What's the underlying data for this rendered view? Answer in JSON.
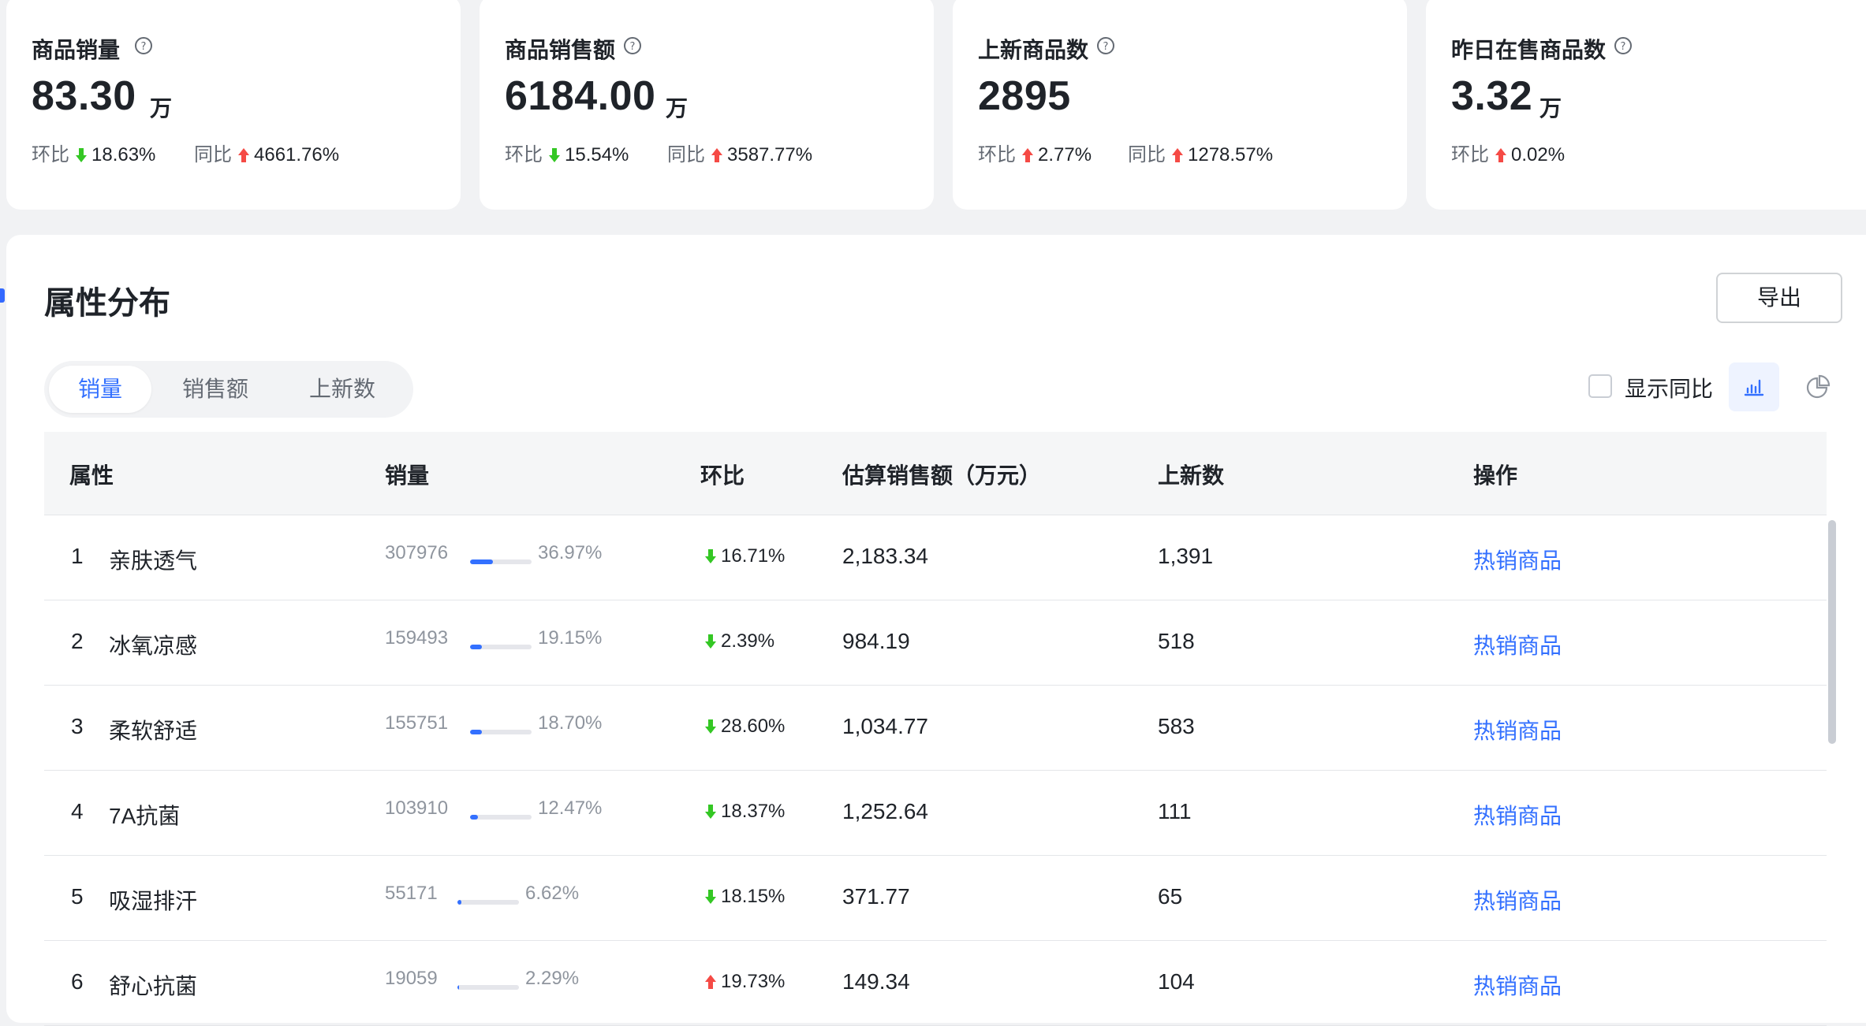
{
  "stats": [
    {
      "title": "商品销量",
      "value": "83.30",
      "unit": "万",
      "mom_label": "环比",
      "mom": "18.63%",
      "mom_dir": "down",
      "yoy_label": "同比",
      "yoy": "4661.76%",
      "yoy_dir": "up"
    },
    {
      "title": "商品销售额",
      "value": "6184.00",
      "unit": "万",
      "mom_label": "环比",
      "mom": "15.54%",
      "mom_dir": "down",
      "yoy_label": "同比",
      "yoy": "3587.77%",
      "yoy_dir": "up"
    },
    {
      "title": "上新商品数",
      "value": "2895",
      "unit": "",
      "mom_label": "环比",
      "mom": "2.77%",
      "mom_dir": "up",
      "yoy_label": "同比",
      "yoy": "1278.57%",
      "yoy_dir": "up"
    },
    {
      "title": "昨日在售商品数",
      "value": "3.32",
      "unit": "万",
      "mom_label": "环比",
      "mom": "0.02%",
      "mom_dir": "up"
    }
  ],
  "section": {
    "title": "属性分布",
    "export_label": "导出"
  },
  "tabs": [
    {
      "label": "销量",
      "active": true
    },
    {
      "label": "销售额",
      "active": false
    },
    {
      "label": "上新数",
      "active": false
    }
  ],
  "controls": {
    "show_yoy_label": "显示同比",
    "show_yoy_checked": false,
    "view_icons": [
      "bar-chart-icon",
      "pie-chart-icon"
    ],
    "active_view": "bar-chart-icon"
  },
  "table": {
    "headers": [
      "属性",
      "销量",
      "环比",
      "估算销售额（万元）",
      "上新数",
      "操作"
    ],
    "rows": [
      {
        "rank": "1",
        "attr": "亲肤透气",
        "sales": "307976",
        "share": "36.97%",
        "share_value": 0.3697,
        "mom": "16.71%",
        "mom_dir": "down",
        "amount": "2,183.34",
        "new": "1,391",
        "op": "热销商品"
      },
      {
        "rank": "2",
        "attr": "冰氧凉感",
        "sales": "159493",
        "share": "19.15%",
        "share_value": 0.1915,
        "mom": "2.39%",
        "mom_dir": "down",
        "amount": "984.19",
        "new": "518",
        "op": "热销商品"
      },
      {
        "rank": "3",
        "attr": "柔软舒适",
        "sales": "155751",
        "share": "18.70%",
        "share_value": 0.187,
        "mom": "28.60%",
        "mom_dir": "down",
        "amount": "1,034.77",
        "new": "583",
        "op": "热销商品"
      },
      {
        "rank": "4",
        "attr": "7A抗菌",
        "sales": "103910",
        "share": "12.47%",
        "share_value": 0.1247,
        "mom": "18.37%",
        "mom_dir": "down",
        "amount": "1,252.64",
        "new": "111",
        "op": "热销商品"
      },
      {
        "rank": "5",
        "attr": "吸湿排汗",
        "sales": "55171",
        "share": "6.62%",
        "share_value": 0.0662,
        "mom": "18.15%",
        "mom_dir": "down",
        "amount": "371.77",
        "new": "65",
        "op": "热销商品"
      },
      {
        "rank": "6",
        "attr": "舒心抗菌",
        "sales": "19059",
        "share": "2.29%",
        "share_value": 0.0229,
        "mom": "19.73%",
        "mom_dir": "up",
        "amount": "149.34",
        "new": "104",
        "op": "热销商品"
      }
    ]
  },
  "colors": {
    "up": "#f54a45",
    "down": "#34c724",
    "accent": "#3370ff"
  }
}
